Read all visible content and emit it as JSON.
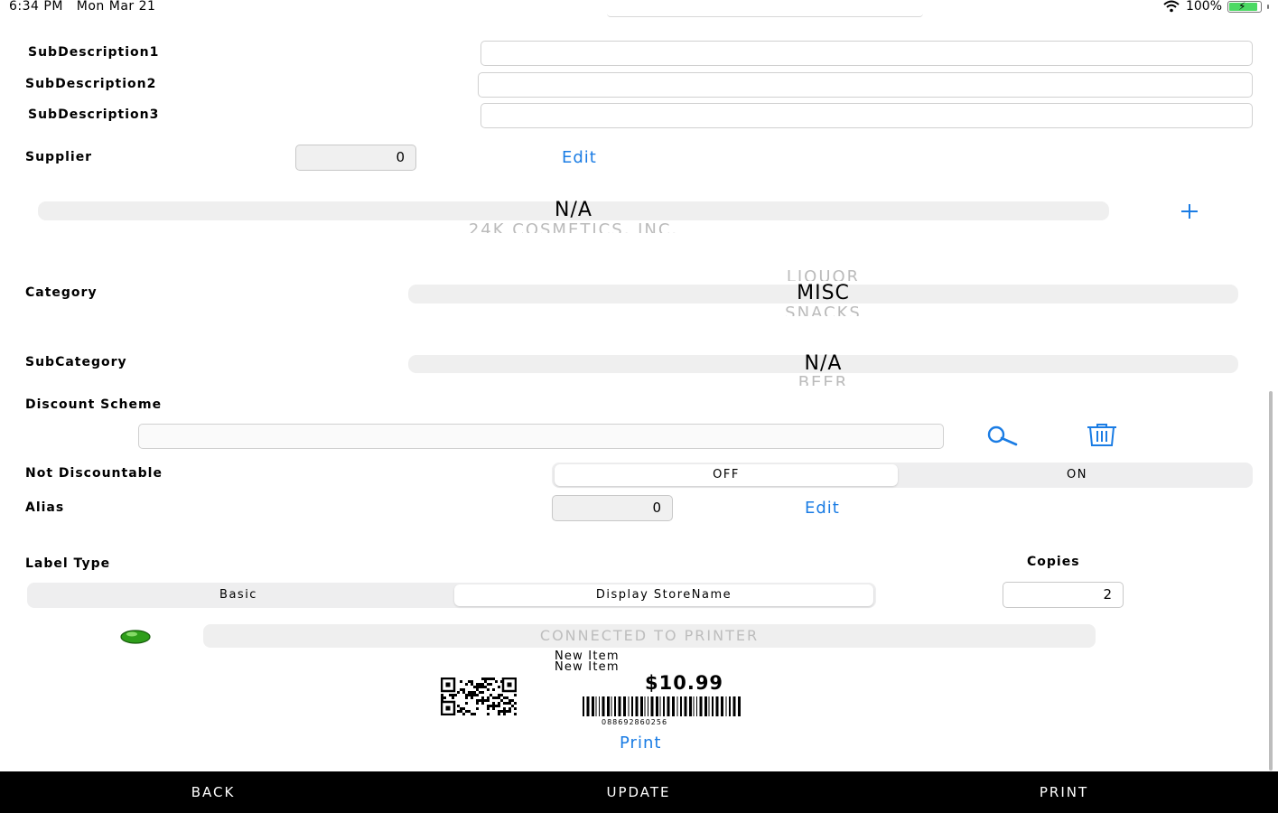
{
  "status_bar": {
    "time": "6:34 PM",
    "date": "Mon Mar 21",
    "battery": "100%",
    "wifi_icon": "wifi-icon",
    "battery_icon": "battery-charging-icon"
  },
  "fields": {
    "subdesc1": {
      "label": "SubDescription1",
      "value": ""
    },
    "subdesc2": {
      "label": "SubDescription2",
      "value": ""
    },
    "subdesc3": {
      "label": "SubDescription3",
      "value": ""
    }
  },
  "supplier": {
    "label": "Supplier",
    "value": "0",
    "edit_label": "Edit",
    "picker_selected": "N/A",
    "picker_next": "24K COSMETICS, INC.",
    "add_icon": "plus-icon"
  },
  "category": {
    "label": "Category",
    "above": "LIQUOR",
    "selected": "MISC",
    "below": "SNACKS"
  },
  "subcategory": {
    "label": "SubCategory",
    "selected": "N/A",
    "below": "BEER"
  },
  "discount_scheme": {
    "label": "Discount Scheme",
    "value": "",
    "search_icon": "search-icon",
    "delete_icon": "trash-icon"
  },
  "not_discountable": {
    "label": "Not Discountable",
    "options": [
      "OFF",
      "ON"
    ],
    "selected": "OFF"
  },
  "alias": {
    "label": "Alias",
    "value": "0",
    "edit_label": "Edit"
  },
  "label_type": {
    "label": "Label Type",
    "options": [
      "Basic",
      "Display StoreName"
    ],
    "selected": "Display StoreName"
  },
  "copies": {
    "label": "Copies",
    "value": "2"
  },
  "printer": {
    "status_text": "CONNECTED TO PRINTER",
    "indicator_color": "#2e9e1a"
  },
  "label_preview": {
    "line1": "New Item",
    "line2": "New Item",
    "price": "$10.99",
    "barcode_number": "088692860256",
    "qr_icon": "qr-code-icon",
    "print_label": "Print"
  },
  "bottom_bar": {
    "back": "BACK",
    "update": "UPDATE",
    "print": "PRINT"
  },
  "colors": {
    "accent": "#1a7ce4",
    "bar_bg": "#000000",
    "segment_bg": "#eeeeef"
  }
}
